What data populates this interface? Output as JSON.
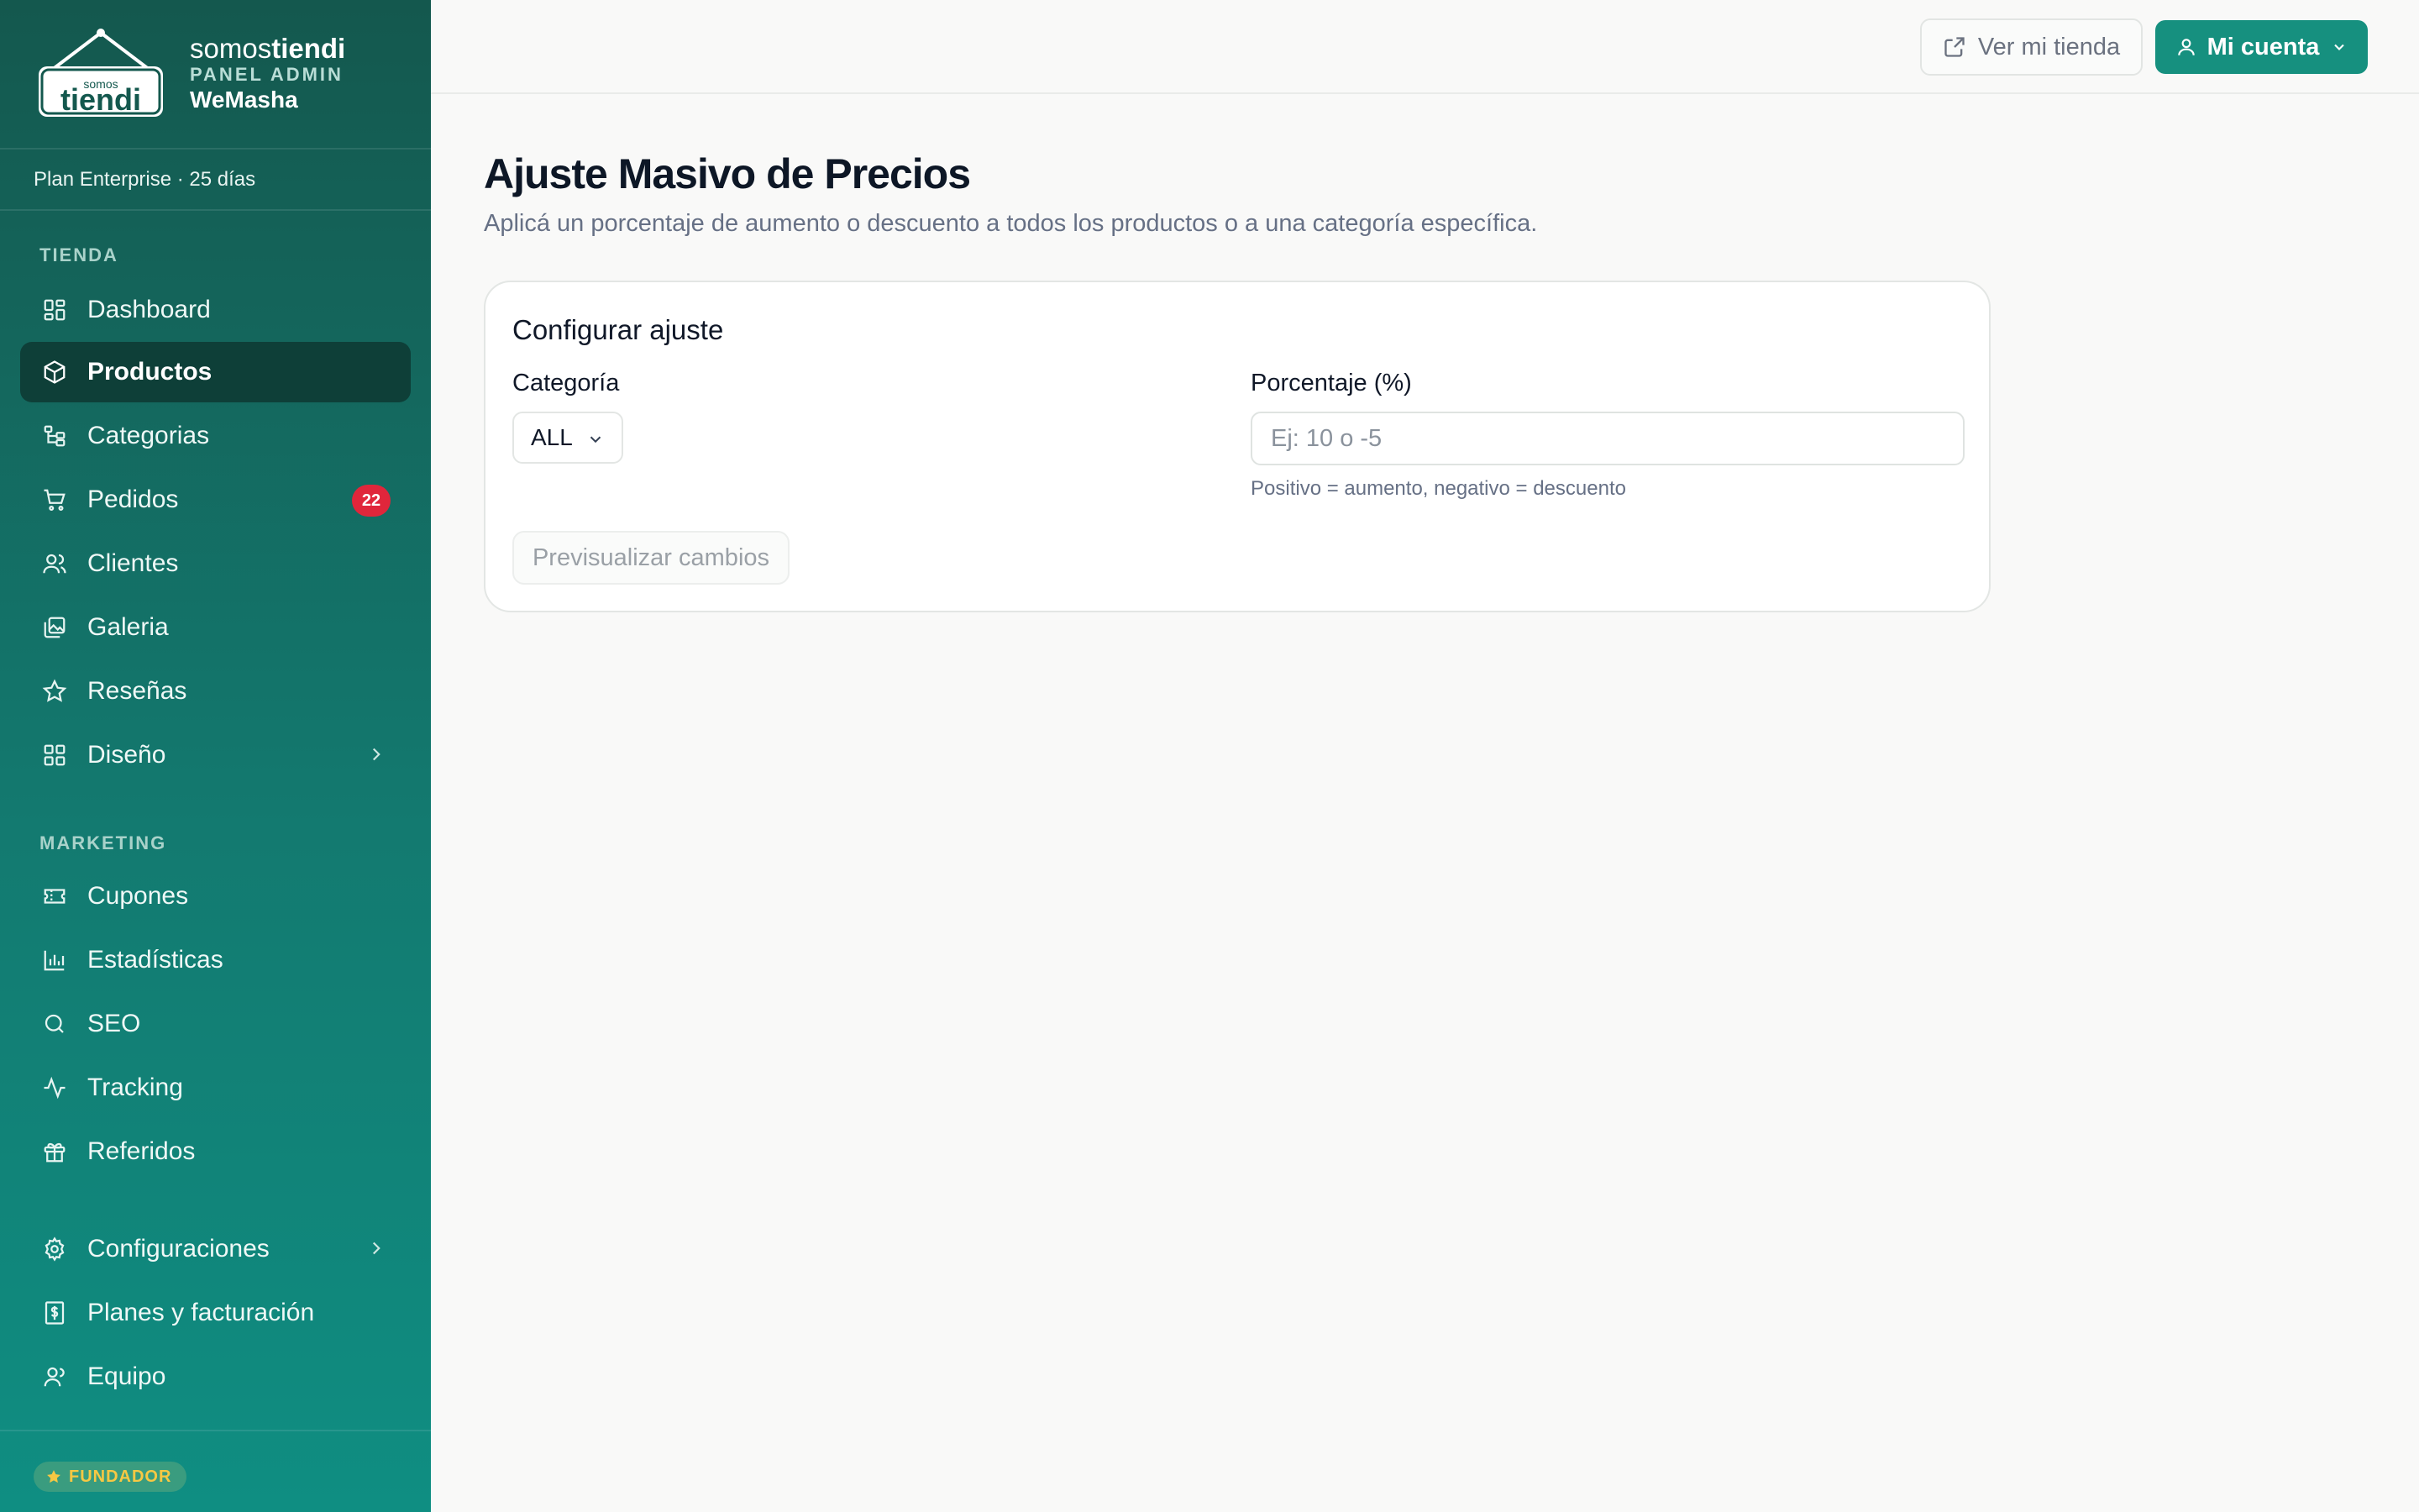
{
  "brand": {
    "name_light": "somos",
    "name_bold": "tiendi",
    "panel_label": "PANEL ADMIN",
    "store_name": "WeMasha",
    "logo_text_small": "somos",
    "logo_text_big": "tiendi"
  },
  "plan": {
    "label": "Plan Enterprise · 25 días"
  },
  "sidebar": {
    "sections": [
      {
        "label": "TIENDA",
        "items": [
          {
            "label": "Dashboard",
            "icon": "dashboard-icon"
          },
          {
            "label": "Productos",
            "icon": "box-icon",
            "active": true
          },
          {
            "label": "Categorias",
            "icon": "tree-icon"
          },
          {
            "label": "Pedidos",
            "icon": "cart-icon",
            "badge": "22"
          },
          {
            "label": "Clientes",
            "icon": "users-icon"
          },
          {
            "label": "Galeria",
            "icon": "gallery-icon"
          },
          {
            "label": "Reseñas",
            "icon": "star-icon"
          },
          {
            "label": "Diseño",
            "icon": "layout-icon",
            "submenu": true
          }
        ]
      },
      {
        "label": "MARKETING",
        "items": [
          {
            "label": "Cupones",
            "icon": "ticket-icon"
          },
          {
            "label": "Estadísticas",
            "icon": "bar-chart-icon"
          },
          {
            "label": "SEO",
            "icon": "search-icon"
          },
          {
            "label": "Tracking",
            "icon": "activity-icon"
          },
          {
            "label": "Referidos",
            "icon": "gift-icon"
          }
        ]
      },
      {
        "label": "",
        "items": [
          {
            "label": "Configuraciones",
            "icon": "gear-icon",
            "submenu": true
          },
          {
            "label": "Planes y facturación",
            "icon": "receipt-icon"
          },
          {
            "label": "Equipo",
            "icon": "team-icon"
          }
        ]
      }
    ],
    "footer_badge": "FUNDADOR"
  },
  "topbar": {
    "view_store_label": "Ver mi tienda",
    "account_label": "Mi cuenta"
  },
  "page": {
    "title": "Ajuste Masivo de Precios",
    "subtitle": "Aplicá un porcentaje de aumento o descuento a todos los productos o a una categoría específica."
  },
  "form": {
    "card_title": "Configurar ajuste",
    "category_label": "Categoría",
    "category_value": "ALL",
    "percent_label": "Porcentaje (%)",
    "percent_value": "",
    "percent_placeholder": "Ej: 10 o -5",
    "percent_hint": "Positivo = aumento, negativo = descuento",
    "preview_button": "Previsualizar cambios"
  },
  "colors": {
    "sidebar_top": "#14584e",
    "sidebar_bottom": "#0f8e82",
    "active_item": "#0e3f38",
    "accent": "#16907f",
    "badge": "#e0263b",
    "founder": "#f7c843"
  }
}
